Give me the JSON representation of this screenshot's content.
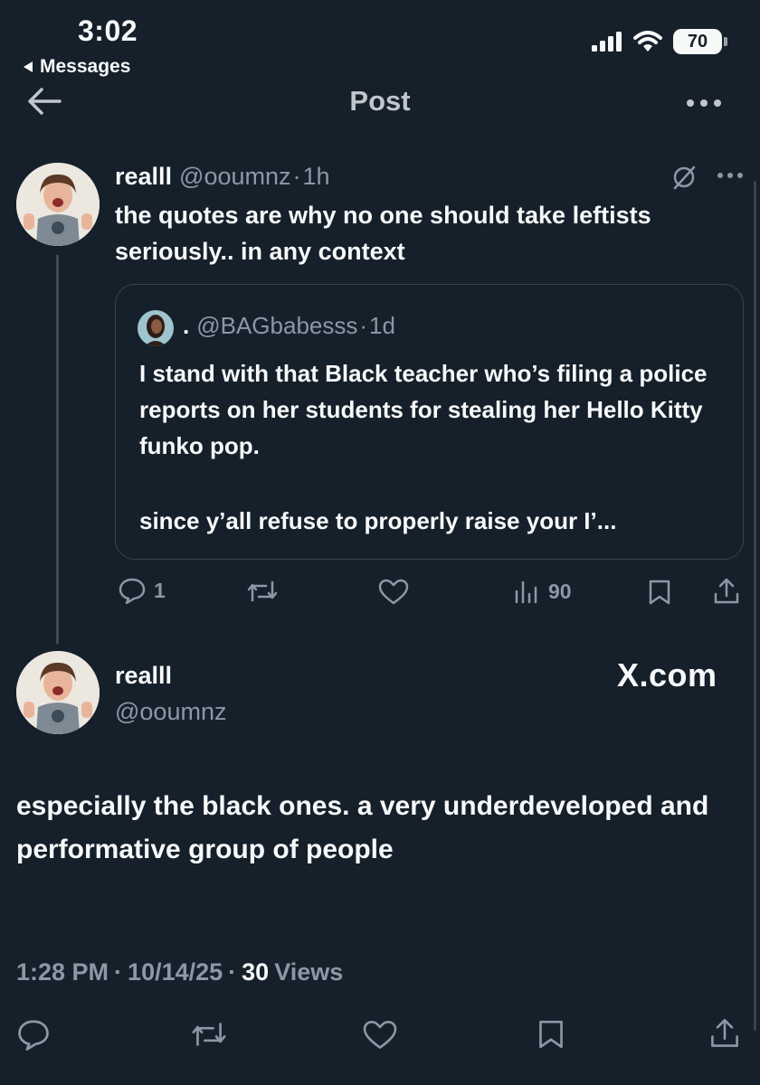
{
  "status_bar": {
    "time": "3:02",
    "back_app": "Messages",
    "battery": "70"
  },
  "header": {
    "title": "Post"
  },
  "parent_tweet": {
    "name": "realll",
    "handle": "@ooumnz",
    "separator": "·",
    "age": "1h",
    "text": "the quotes are why no one should take leftists seriously.. in any context",
    "quote": {
      "name": ".",
      "handle": "@BAGbabesss",
      "separator": "·",
      "age": "1d",
      "text_1": "I stand with that Black teacher who’s filing a police reports on her students for stealing her Hello Kitty funko pop.",
      "text_2": "since y’all refuse to properly raise your I’..."
    },
    "actions": {
      "replies": "1",
      "views": "90"
    }
  },
  "main_tweet": {
    "name": "realll",
    "handle": "@ooumnz",
    "watermark": "X.com",
    "text": "especially the black ones. a very underdeveloped and performative group of people",
    "time": "1:28 PM",
    "sep1": "·",
    "date": "10/14/25",
    "sep2": "·",
    "views_count": "30",
    "views_label": "Views"
  },
  "colors": {
    "background": "#15202b",
    "text": "#f7f9f9",
    "muted": "#8b98a5",
    "border": "#38444d"
  }
}
